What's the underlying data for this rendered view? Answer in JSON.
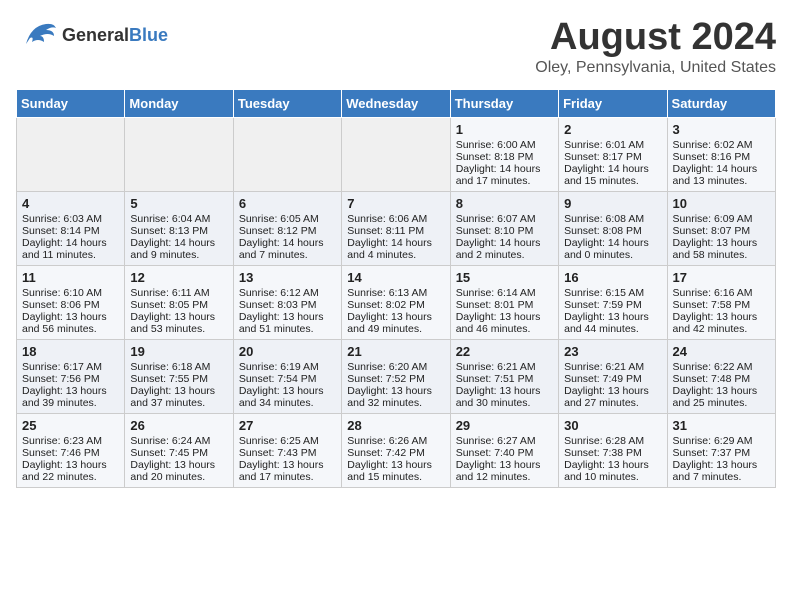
{
  "header": {
    "logo_general": "General",
    "logo_blue": "Blue",
    "month_title": "August 2024",
    "location": "Oley, Pennsylvania, United States"
  },
  "days_of_week": [
    "Sunday",
    "Monday",
    "Tuesday",
    "Wednesday",
    "Thursday",
    "Friday",
    "Saturday"
  ],
  "weeks": [
    [
      {
        "day": "",
        "content": ""
      },
      {
        "day": "",
        "content": ""
      },
      {
        "day": "",
        "content": ""
      },
      {
        "day": "",
        "content": ""
      },
      {
        "day": "1",
        "content": "Sunrise: 6:00 AM\nSunset: 8:18 PM\nDaylight: 14 hours\nand 17 minutes."
      },
      {
        "day": "2",
        "content": "Sunrise: 6:01 AM\nSunset: 8:17 PM\nDaylight: 14 hours\nand 15 minutes."
      },
      {
        "day": "3",
        "content": "Sunrise: 6:02 AM\nSunset: 8:16 PM\nDaylight: 14 hours\nand 13 minutes."
      }
    ],
    [
      {
        "day": "4",
        "content": "Sunrise: 6:03 AM\nSunset: 8:14 PM\nDaylight: 14 hours\nand 11 minutes."
      },
      {
        "day": "5",
        "content": "Sunrise: 6:04 AM\nSunset: 8:13 PM\nDaylight: 14 hours\nand 9 minutes."
      },
      {
        "day": "6",
        "content": "Sunrise: 6:05 AM\nSunset: 8:12 PM\nDaylight: 14 hours\nand 7 minutes."
      },
      {
        "day": "7",
        "content": "Sunrise: 6:06 AM\nSunset: 8:11 PM\nDaylight: 14 hours\nand 4 minutes."
      },
      {
        "day": "8",
        "content": "Sunrise: 6:07 AM\nSunset: 8:10 PM\nDaylight: 14 hours\nand 2 minutes."
      },
      {
        "day": "9",
        "content": "Sunrise: 6:08 AM\nSunset: 8:08 PM\nDaylight: 14 hours\nand 0 minutes."
      },
      {
        "day": "10",
        "content": "Sunrise: 6:09 AM\nSunset: 8:07 PM\nDaylight: 13 hours\nand 58 minutes."
      }
    ],
    [
      {
        "day": "11",
        "content": "Sunrise: 6:10 AM\nSunset: 8:06 PM\nDaylight: 13 hours\nand 56 minutes."
      },
      {
        "day": "12",
        "content": "Sunrise: 6:11 AM\nSunset: 8:05 PM\nDaylight: 13 hours\nand 53 minutes."
      },
      {
        "day": "13",
        "content": "Sunrise: 6:12 AM\nSunset: 8:03 PM\nDaylight: 13 hours\nand 51 minutes."
      },
      {
        "day": "14",
        "content": "Sunrise: 6:13 AM\nSunset: 8:02 PM\nDaylight: 13 hours\nand 49 minutes."
      },
      {
        "day": "15",
        "content": "Sunrise: 6:14 AM\nSunset: 8:01 PM\nDaylight: 13 hours\nand 46 minutes."
      },
      {
        "day": "16",
        "content": "Sunrise: 6:15 AM\nSunset: 7:59 PM\nDaylight: 13 hours\nand 44 minutes."
      },
      {
        "day": "17",
        "content": "Sunrise: 6:16 AM\nSunset: 7:58 PM\nDaylight: 13 hours\nand 42 minutes."
      }
    ],
    [
      {
        "day": "18",
        "content": "Sunrise: 6:17 AM\nSunset: 7:56 PM\nDaylight: 13 hours\nand 39 minutes."
      },
      {
        "day": "19",
        "content": "Sunrise: 6:18 AM\nSunset: 7:55 PM\nDaylight: 13 hours\nand 37 minutes."
      },
      {
        "day": "20",
        "content": "Sunrise: 6:19 AM\nSunset: 7:54 PM\nDaylight: 13 hours\nand 34 minutes."
      },
      {
        "day": "21",
        "content": "Sunrise: 6:20 AM\nSunset: 7:52 PM\nDaylight: 13 hours\nand 32 minutes."
      },
      {
        "day": "22",
        "content": "Sunrise: 6:21 AM\nSunset: 7:51 PM\nDaylight: 13 hours\nand 30 minutes."
      },
      {
        "day": "23",
        "content": "Sunrise: 6:21 AM\nSunset: 7:49 PM\nDaylight: 13 hours\nand 27 minutes."
      },
      {
        "day": "24",
        "content": "Sunrise: 6:22 AM\nSunset: 7:48 PM\nDaylight: 13 hours\nand 25 minutes."
      }
    ],
    [
      {
        "day": "25",
        "content": "Sunrise: 6:23 AM\nSunset: 7:46 PM\nDaylight: 13 hours\nand 22 minutes."
      },
      {
        "day": "26",
        "content": "Sunrise: 6:24 AM\nSunset: 7:45 PM\nDaylight: 13 hours\nand 20 minutes."
      },
      {
        "day": "27",
        "content": "Sunrise: 6:25 AM\nSunset: 7:43 PM\nDaylight: 13 hours\nand 17 minutes."
      },
      {
        "day": "28",
        "content": "Sunrise: 6:26 AM\nSunset: 7:42 PM\nDaylight: 13 hours\nand 15 minutes."
      },
      {
        "day": "29",
        "content": "Sunrise: 6:27 AM\nSunset: 7:40 PM\nDaylight: 13 hours\nand 12 minutes."
      },
      {
        "day": "30",
        "content": "Sunrise: 6:28 AM\nSunset: 7:38 PM\nDaylight: 13 hours\nand 10 minutes."
      },
      {
        "day": "31",
        "content": "Sunrise: 6:29 AM\nSunset: 7:37 PM\nDaylight: 13 hours\nand 7 minutes."
      }
    ]
  ]
}
